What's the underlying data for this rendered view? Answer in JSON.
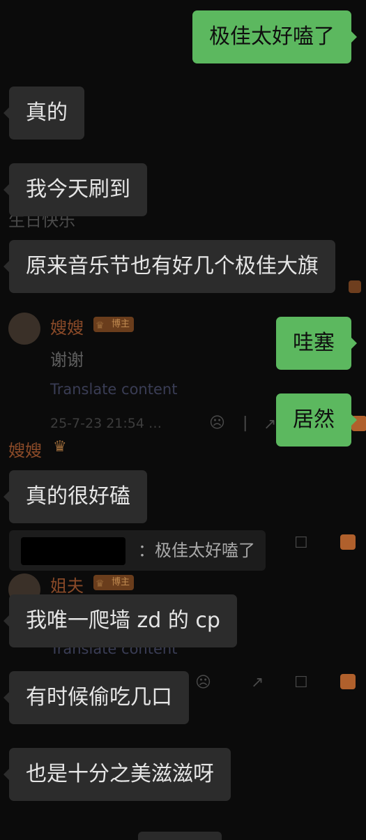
{
  "background_comments": {
    "partial_text": "生日快乐",
    "comment1": {
      "username": "嫂嫂",
      "badge": "博主",
      "body": "谢谢",
      "translate": "Translate content",
      "timestamp": "25-7-23 21:54 …"
    },
    "comment2": {
      "username": "嫂嫂"
    },
    "comment3": {
      "username": "姐夫",
      "badge": "博主",
      "translate": "Translate content"
    }
  },
  "messages": [
    {
      "side": "right",
      "text": "极佳太好嗑了"
    },
    {
      "side": "left",
      "text": "真的"
    },
    {
      "side": "left",
      "text": "我今天刷到"
    },
    {
      "side": "left",
      "text": "原来音乐节也有好几个极佳大旗"
    },
    {
      "side": "right",
      "text": "哇塞"
    },
    {
      "side": "right",
      "text": "居然"
    },
    {
      "side": "left",
      "text": "真的很好磕"
    },
    {
      "side": "left",
      "text": "我唯一爬墙 zd 的 cp"
    },
    {
      "side": "left",
      "text": "有时候偷吃几口"
    },
    {
      "side": "left",
      "text": "也是十分之美滋滋呀"
    }
  ],
  "quote": {
    "text": "：极佳太好嗑了"
  },
  "colors": {
    "background": "#0b0b0b",
    "bubble_left": "#2c2c2c",
    "bubble_right": "#5cb85f"
  }
}
